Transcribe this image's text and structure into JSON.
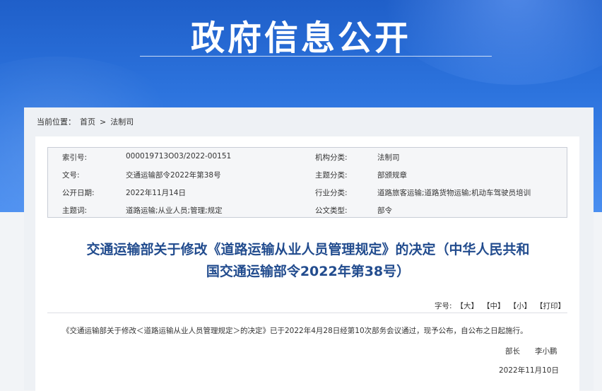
{
  "banner": {
    "title": "政府信息公开"
  },
  "breadcrumb": {
    "label": "当前位置：",
    "items": [
      "首页",
      "法制司"
    ],
    "separator": ">"
  },
  "meta": {
    "rows": [
      {
        "k1": "索引号:",
        "v1": "000019713O03/2022-00151",
        "k2": "机构分类:",
        "v2": "法制司"
      },
      {
        "k1": "文号:",
        "v1": "交通运输部令2022年第38号",
        "k2": "主题分类:",
        "v2": "部颁规章"
      },
      {
        "k1": "公开日期:",
        "v1": "2022年11月14日",
        "k2": "行业分类:",
        "v2": "道路旅客运输;道路货物运输;机动车驾驶员培训"
      },
      {
        "k1": "主题词:",
        "v1": "道路运输;从业人员;管理;规定",
        "k2": "公文类型:",
        "v2": "部令"
      }
    ]
  },
  "document": {
    "title_line1": "交通运输部关于修改《道路运输从业人员管理规定》的决定（中华人民共和",
    "title_line2": "国交通运输部令2022年第38号）",
    "paragraph": "《交通运输部关于修改＜道路运输从业人员管理规定＞的决定》已于2022年4月28日经第10次部务会议通过，现予公布，自公布之日起施行。",
    "sign_role": "部长",
    "sign_name": "李小鹏",
    "date": "2022年11月10日"
  },
  "fontsize": {
    "label": "字号:",
    "large": "【大】",
    "medium": "【中】",
    "small": "【小】",
    "print": "【打印】"
  }
}
